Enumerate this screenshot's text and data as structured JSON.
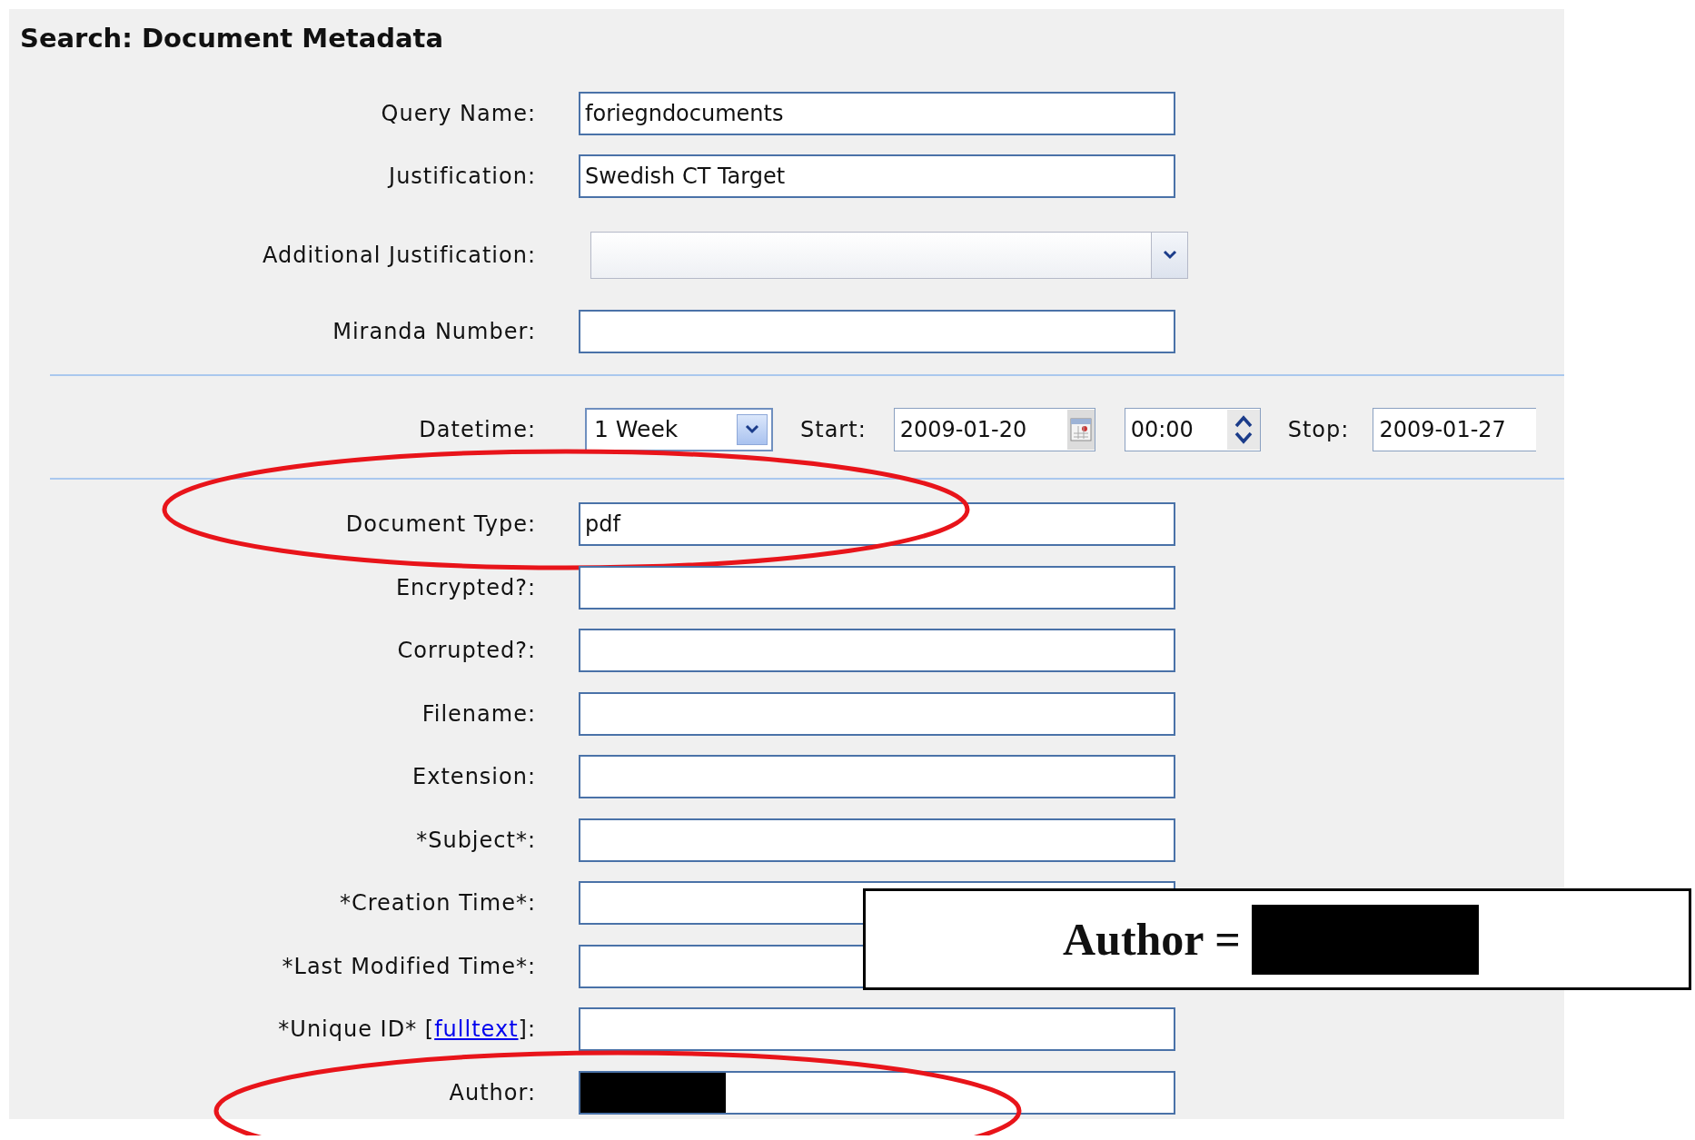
{
  "title": "Search: Document Metadata",
  "query_fields": [
    {
      "kind": "text",
      "label": "Query Name:",
      "value": "foriegndocuments"
    },
    {
      "kind": "text",
      "label": "Justification:",
      "value": "Swedish CT Target"
    },
    {
      "kind": "select",
      "label": "Additional Justification:"
    },
    {
      "kind": "text",
      "label": "Miranda Number:"
    }
  ],
  "datetime": {
    "label": "Datetime:",
    "range": "1 Week",
    "start_label": "Start:",
    "start_date": "2009-01-20",
    "start_time": "00:00",
    "stop_label": "Stop:",
    "stop_date": "2009-01-27"
  },
  "metadata_fields": [
    {
      "label": "Document Type:",
      "value": "pdf",
      "highlighted": true
    },
    {
      "label": "Encrypted?:",
      "highlighted": false
    },
    {
      "label": "Corrupted?:",
      "highlighted": false
    },
    {
      "label": "Filename:",
      "highlighted": false
    },
    {
      "label": "Extension:",
      "highlighted": false
    },
    {
      "label": "*Subject*:",
      "highlighted": false
    },
    {
      "label": "*Creation Time*:",
      "highlighted": false
    },
    {
      "label": "*Last Modified Time*:",
      "highlighted": false
    },
    {
      "label": "*Unique ID* [",
      "link": "fulltext",
      "label_end": "]:",
      "highlighted": false
    },
    {
      "label": "Author:",
      "redacted": true,
      "highlighted": true
    }
  ],
  "callout": {
    "text": "Author =",
    "redacted": true
  }
}
